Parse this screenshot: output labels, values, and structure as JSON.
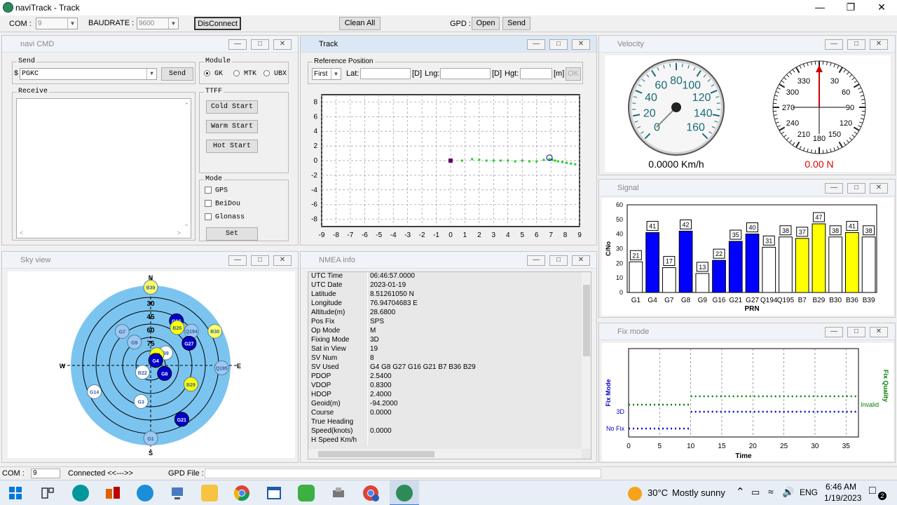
{
  "window": {
    "title": "naviTrack - Track"
  },
  "toolbar": {
    "com_label": "COM :",
    "com_value": "9",
    "baud_label": "BAUDRATE :",
    "baud_value": "9600",
    "disconnect": "DisConnect",
    "clean_all": "Clean All",
    "gpd_label": "GPD :",
    "open": "Open",
    "send": "Send"
  },
  "navi_cmd": {
    "title": "navi CMD",
    "send_group": "Send",
    "send_prefix": "$",
    "send_value": "PGKC",
    "send_button": "Send",
    "module_group": "Module",
    "module_options": [
      "GK",
      "MTK",
      "UBX"
    ],
    "module_selected": "GK",
    "receive_group": "Receive",
    "ttff_group": "TTFF",
    "cold_start": "Cold Start",
    "warm_start": "Warm Start",
    "hot_start": "Hot  Start",
    "mode_group": "Mode",
    "modes": [
      "GPS",
      "BeiDou",
      "Glonass"
    ],
    "set": "Set"
  },
  "track": {
    "title": "Track",
    "ref_group": "Reference Position",
    "first": "First",
    "lat": "Lat:",
    "deg1": "[D]",
    "lng": "Lng:",
    "deg2": "[D]",
    "hgt": "Hgt:",
    "m": "[m]",
    "ok": "OK",
    "chart_data": {
      "type": "scatter",
      "xlim": [
        -9,
        9
      ],
      "ylim": [
        -9,
        9
      ],
      "x_ticks": [
        -9,
        -8,
        -7,
        -6,
        -5,
        -4,
        -3,
        -2,
        -1,
        0,
        1,
        2,
        3,
        4,
        5,
        6,
        7,
        8,
        9
      ],
      "y_ticks": [
        8,
        6,
        4,
        2,
        0,
        -2,
        -4,
        -6,
        -8
      ],
      "origin": [
        0,
        0
      ],
      "current": [
        6.9,
        0.4
      ],
      "points": [
        [
          0.8,
          0.0
        ],
        [
          1.5,
          0.2
        ],
        [
          2.0,
          0.1
        ],
        [
          2.5,
          0.0
        ],
        [
          3.0,
          0.0
        ],
        [
          3.5,
          0.0
        ],
        [
          4.0,
          0.0
        ],
        [
          4.5,
          -0.1
        ],
        [
          5.0,
          0.0
        ],
        [
          5.5,
          -0.1
        ],
        [
          6.0,
          -0.1
        ],
        [
          6.5,
          0.1
        ],
        [
          6.9,
          0.2
        ],
        [
          7.1,
          0.1
        ],
        [
          7.3,
          0.0
        ],
        [
          7.5,
          -0.1
        ],
        [
          7.8,
          -0.2
        ],
        [
          8.1,
          -0.3
        ],
        [
          8.4,
          -0.4
        ],
        [
          8.7,
          -0.5
        ]
      ]
    }
  },
  "velocity": {
    "title": "Velocity",
    "speed_ticks": [
      "0",
      "20",
      "40",
      "60",
      "80",
      "100",
      "120",
      "140",
      "160"
    ],
    "speed_value": 0,
    "speed_text": "0.0000 Km/h",
    "compass_ticks": [
      "330",
      "30",
      "300",
      "60",
      "270",
      "90",
      "240",
      "120",
      "210",
      "180",
      "150"
    ],
    "heading_value": 0,
    "heading_text": "0.00 N"
  },
  "signal": {
    "title": "Signal",
    "chart_data": {
      "type": "bar",
      "ylabel": "C/No",
      "xlabel": "PRN",
      "ylim": [
        0,
        60
      ],
      "y_ticks": [
        0,
        10,
        20,
        30,
        40,
        50,
        60
      ],
      "categories": [
        "G1",
        "G4",
        "G7",
        "G8",
        "G9",
        "G16",
        "G21",
        "G27",
        "Q194",
        "Q195",
        "B7",
        "B29",
        "B30",
        "B36",
        "B39"
      ],
      "values": [
        21,
        41,
        17,
        42,
        13,
        22,
        35,
        40,
        31,
        38,
        37,
        47,
        38,
        41,
        38
      ],
      "colors": [
        "#ffffff",
        "#0000ff",
        "#ffffff",
        "#0000ff",
        "#ffffff",
        "#0000ff",
        "#0000ff",
        "#0000ff",
        "#ffffff",
        "#ffffff",
        "#ffff00",
        "#ffff00",
        "#ffffff",
        "#ffff00",
        "#ffffff"
      ]
    }
  },
  "sky": {
    "title": "Sky view",
    "dirs": {
      "n": "N",
      "s": "S",
      "e": "E",
      "w": "W"
    },
    "rings": [
      "15",
      "30",
      "45",
      "60",
      "75"
    ],
    "sats": [
      {
        "id": "B39",
        "az": 0,
        "el": 2,
        "color": "#ffff66"
      },
      {
        "id": "G7",
        "az": -40,
        "el": 40,
        "color": "#9ec8f0"
      },
      {
        "id": "G9",
        "az": -35,
        "el": 58,
        "color": "#9ec8f0"
      },
      {
        "id": "G16",
        "az": 30,
        "el": 32,
        "color": "#0000cc"
      },
      {
        "id": "B26",
        "az": 35,
        "el": 38,
        "color": "#ffff00"
      },
      {
        "id": "Q194",
        "az": 50,
        "el": 30,
        "color": "#9ec8f0"
      },
      {
        "id": "B30",
        "az": 62,
        "el": 8,
        "color": "#ffff66"
      },
      {
        "id": "G27",
        "az": 60,
        "el": 40,
        "color": "#0000cc"
      },
      {
        "id": "B9",
        "az": 50,
        "el": 68,
        "color": "#ffffff"
      },
      {
        "id": "B7",
        "az": 30,
        "el": 76,
        "color": "#ffff00"
      },
      {
        "id": "G4",
        "az": 45,
        "el": 82,
        "color": "#0000cc"
      },
      {
        "id": "G8",
        "az": 120,
        "el": 72,
        "color": "#0000cc"
      },
      {
        "id": "Q195",
        "az": 92,
        "el": 10,
        "color": "#9ec8f0"
      },
      {
        "id": "B22",
        "az": -130,
        "el": 78,
        "color": "#ffffff"
      },
      {
        "id": "B29",
        "az": 115,
        "el": 40,
        "color": "#ffff00"
      },
      {
        "id": "G14",
        "az": -115,
        "el": 20,
        "color": "#ffffff"
      },
      {
        "id": "G3",
        "az": -165,
        "el": 48,
        "color": "#ffffff"
      },
      {
        "id": "G21",
        "az": 150,
        "el": 20,
        "color": "#0000cc"
      },
      {
        "id": "G1",
        "az": 180,
        "el": 8,
        "color": "#9ec8f0"
      }
    ]
  },
  "nmea": {
    "title": "NMEA info",
    "rows": [
      {
        "k": "UTC Time",
        "v": "06:46:57.0000"
      },
      {
        "k": "UTC Date",
        "v": "2023-01-19"
      },
      {
        "k": "Latitude",
        "v": "8.51261050 N"
      },
      {
        "k": "Longitude",
        "v": "76.94704683 E"
      },
      {
        "k": "Altitude(m)",
        "v": "28.6800"
      },
      {
        "k": "Pos Fix",
        "v": "SPS"
      },
      {
        "k": "Op Mode",
        "v": "M"
      },
      {
        "k": "Fixing Mode",
        "v": "3D"
      },
      {
        "k": "Sat in View",
        "v": "19"
      },
      {
        "k": "SV Num",
        "v": "8"
      },
      {
        "k": "SV Used",
        "v": "G4 G8 G27 G16 G21 B7 B36 B29"
      },
      {
        "k": "PDOP",
        "v": "2.5400"
      },
      {
        "k": "VDOP",
        "v": "0.8300"
      },
      {
        "k": "HDOP",
        "v": "2.4000"
      },
      {
        "k": "Geoid(m)",
        "v": "-94.2000"
      },
      {
        "k": "Course",
        "v": "0.0000"
      },
      {
        "k": "True Heading",
        "v": ""
      },
      {
        "k": "Speed(knots)",
        "v": "0.0000"
      },
      {
        "k": "H Speed Km/h",
        "v": ""
      }
    ]
  },
  "fix_mode": {
    "title": "Fix mode",
    "chart_data": {
      "type": "line",
      "xlabel": "Time",
      "ylabel_left": "Fix Mode",
      "ylabel_right": "Fix Quality",
      "xlim": [
        0,
        37
      ],
      "x_ticks": [
        0,
        5,
        10,
        15,
        20,
        25,
        30,
        35
      ],
      "y_labels": [
        "3D",
        "No Fix"
      ],
      "right_label": "Invalid",
      "series": [
        {
          "color": "#0000cc",
          "segments": [
            [
              0,
              10,
              "No Fix"
            ],
            [
              10,
              37,
              "3D"
            ]
          ]
        },
        {
          "color": "#008000",
          "segments": [
            [
              0,
              10,
              "Invalid"
            ],
            [
              10,
              37,
              "Invalid"
            ]
          ]
        }
      ]
    }
  },
  "statusbar": {
    "com_label": "COM :",
    "com_value": "9",
    "status": "Connected <<--->>",
    "gpd_file": "GPD File :"
  },
  "taskbar": {
    "temp": "30°C",
    "weather": "Mostly sunny",
    "lang": "ENG",
    "time": "6:46 AM",
    "date": "1/19/2023",
    "notif": "2"
  }
}
